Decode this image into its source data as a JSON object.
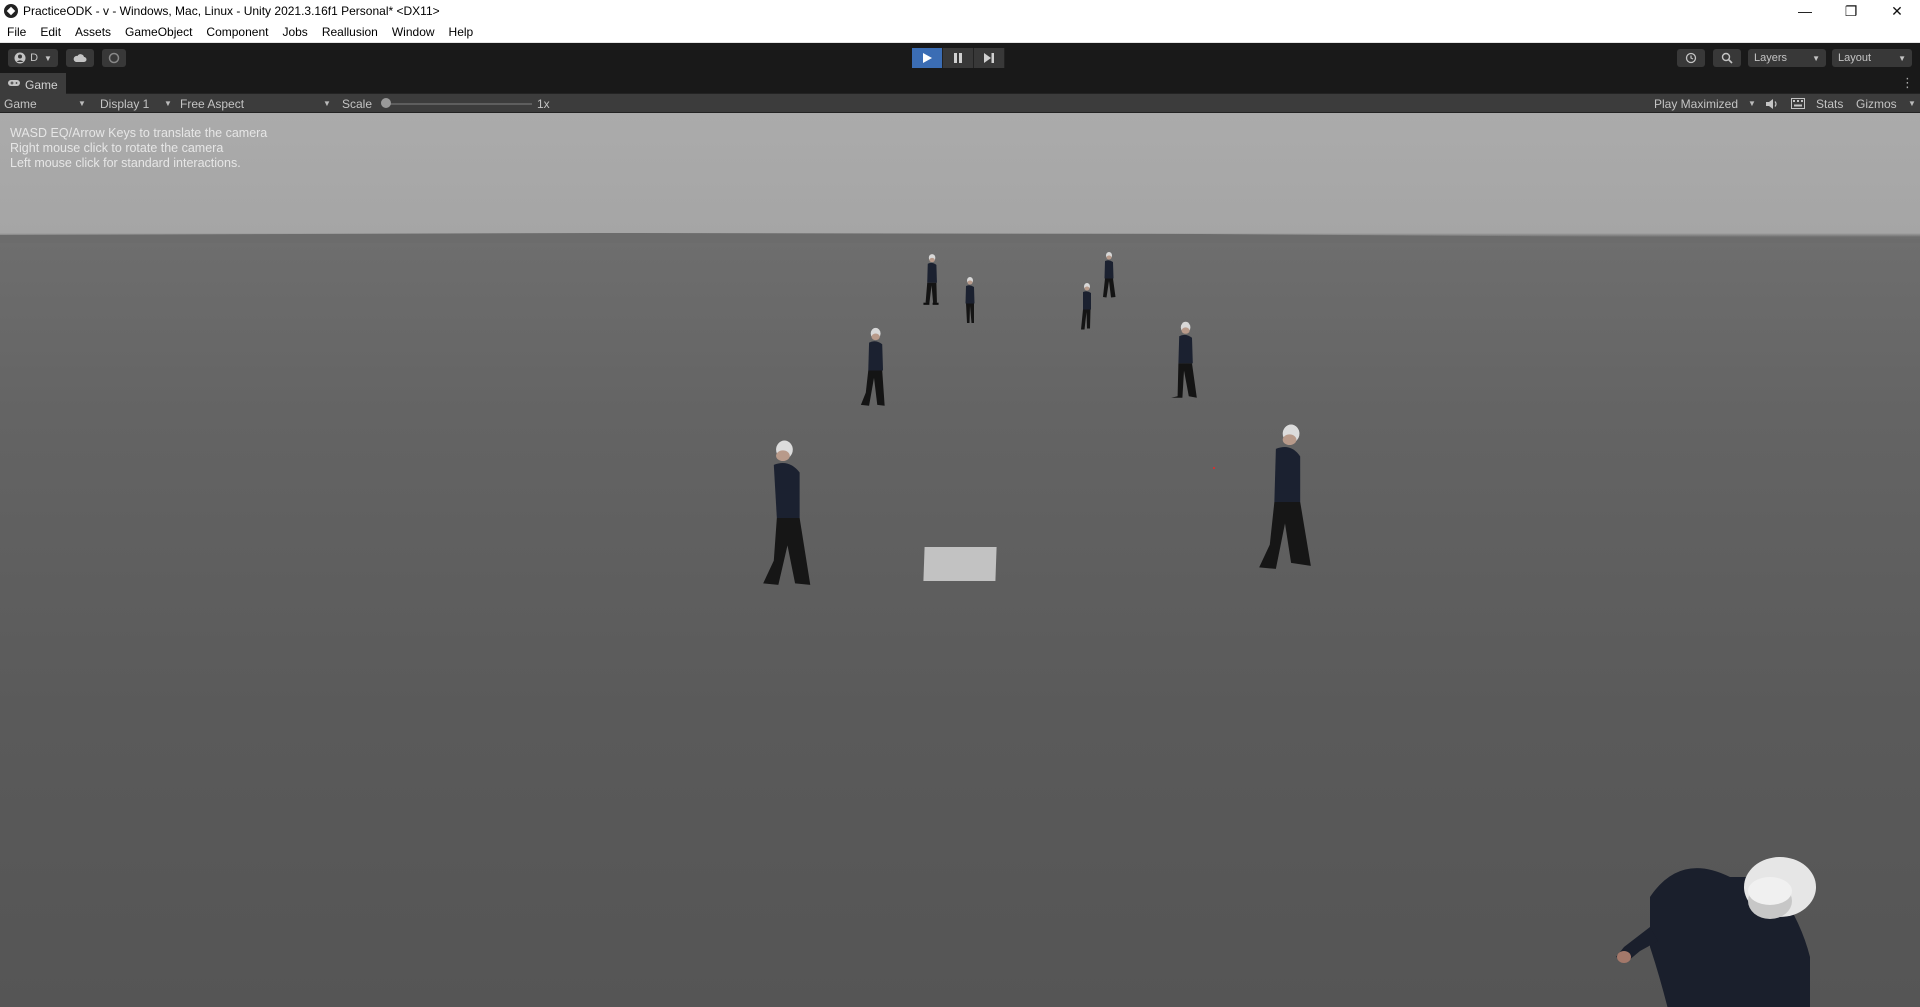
{
  "window": {
    "title": "PracticeODK - v - Windows, Mac, Linux - Unity 2021.3.16f1 Personal* <DX11>",
    "controls": {
      "minimize": "—",
      "restore": "❐",
      "close": "✕"
    }
  },
  "menu": [
    "File",
    "Edit",
    "Assets",
    "GameObject",
    "Component",
    "Jobs",
    "Reallusion",
    "Window",
    "Help"
  ],
  "toolbar": {
    "account_label": "D",
    "layers_label": "Layers",
    "layout_label": "Layout",
    "play_state": "playing"
  },
  "tab": {
    "label": "Game"
  },
  "gamebar": {
    "view_select": "Game",
    "display_select": "Display 1",
    "aspect_select": "Free Aspect",
    "scale_label": "Scale",
    "scale_value": "1x",
    "play_mode_select": "Play Maximized",
    "stats_label": "Stats",
    "gizmos_label": "Gizmos"
  },
  "viewport": {
    "instructions": [
      "WASD EQ/Arrow Keys to translate the camera",
      "Right mouse click to rotate the camera",
      "Left mouse click for standard interactions."
    ],
    "character_count": 10
  }
}
